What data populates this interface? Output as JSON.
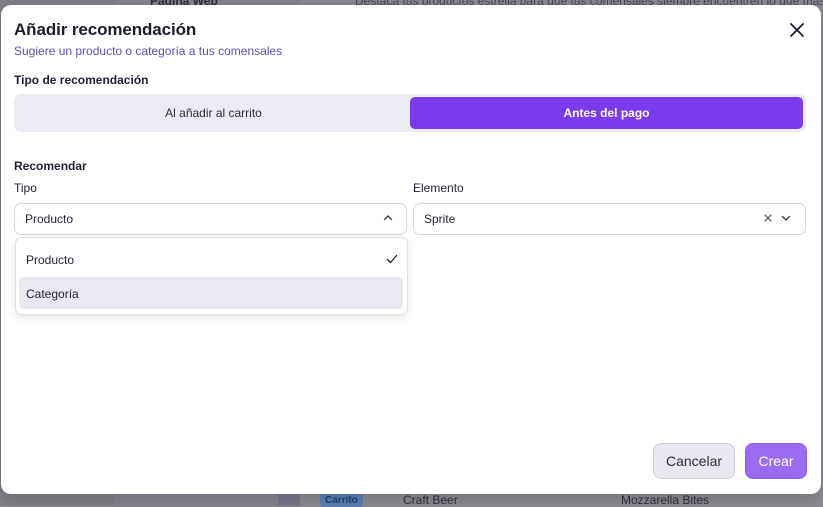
{
  "background": {
    "nav_item": "Página Web",
    "top_text": "Destaca tus productos estrella para que tus comensales siempre encuentren lo que más",
    "row": {
      "badge": "Carrito",
      "item": "Craft Beer",
      "recommendation": "Mozzarella Bites"
    }
  },
  "modal": {
    "title": "Añadir recomendación",
    "subtitle": "Sugiere un producto o categoría a tus comensales",
    "close_icon": "close-icon"
  },
  "type_section": {
    "label": "Tipo de recomendación",
    "options": [
      "Al añadir al carrito",
      "Antes del pago"
    ],
    "selected": "Antes del pago"
  },
  "recommend": {
    "heading": "Recomendar",
    "tipo_label": "Tipo",
    "tipo_value": "Producto",
    "elemento_label": "Elemento",
    "elemento_value": "Sprite",
    "dropdown_options": [
      "Producto",
      "Categoría"
    ],
    "dropdown_selected": "Producto",
    "dropdown_hovered": "Categoría"
  },
  "footer": {
    "cancel_label": "Cancelar",
    "create_label": "Crear"
  },
  "colors": {
    "accent": "#7c3aed",
    "create_button": "#9b6cf3",
    "subtitle": "#5b4fb3"
  }
}
